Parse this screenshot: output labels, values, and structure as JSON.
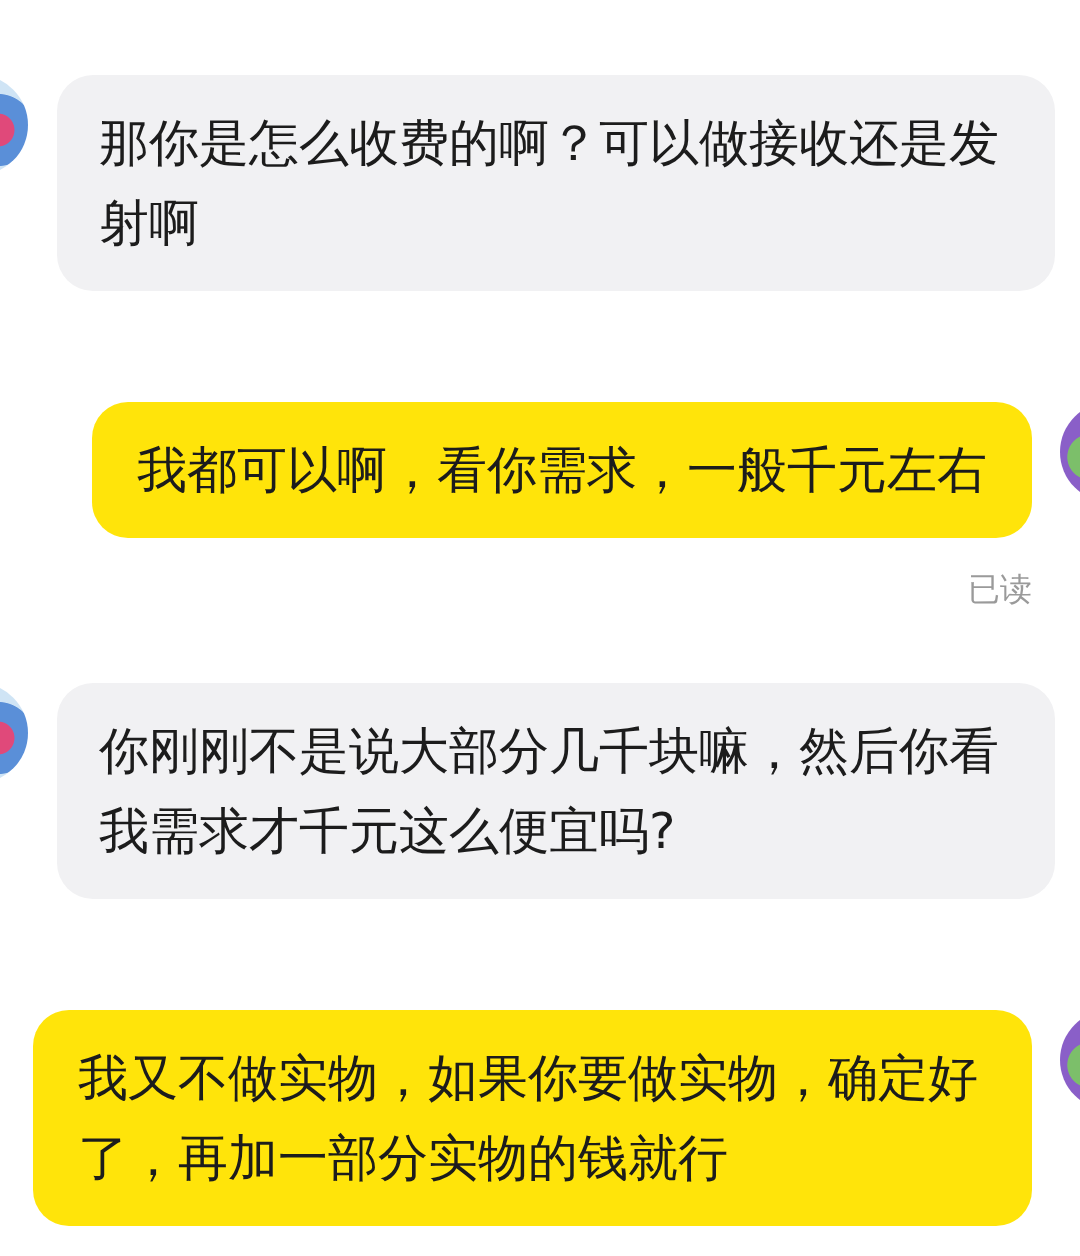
{
  "messages": [
    {
      "kind": "incoming",
      "text": "那你是怎么收费的啊？可以做接收还是发射啊"
    },
    {
      "kind": "outgoing",
      "text": "我都可以啊，看你需求，一般千元左右",
      "receipt": "已读"
    },
    {
      "kind": "incoming",
      "text": "你刚刚不是说大部分几千块嘛，然后你看我需求才千元这么便宜吗?"
    },
    {
      "kind": "outgoing",
      "text": "我又不做实物，如果你要做实物，确定好了，再加一部分实物的钱就行"
    }
  ]
}
